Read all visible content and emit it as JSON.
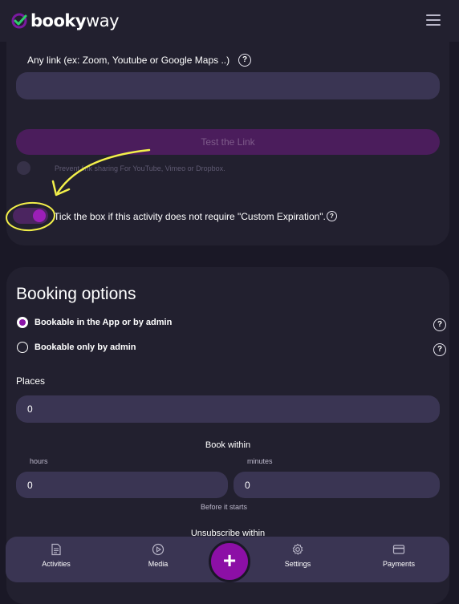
{
  "app": {
    "logo_bold": "booky",
    "logo_light": "way"
  },
  "link_section": {
    "label": "Any link (ex: Zoom, Youtube or Google Maps ..)",
    "value": "",
    "test_button": "Test the Link",
    "prevent_sharing_hint": "Prevent link sharing For YouTube, Vimeo or Dropbox.",
    "prevent_sharing_on": false,
    "custom_expiration_label": "Tick the box if this activity does not require \"Custom Expiration\".",
    "custom_expiration_on": true
  },
  "booking": {
    "title": "Booking options",
    "options": [
      {
        "label": "Bookable in the App or by admin",
        "selected": true
      },
      {
        "label": "Bookable only by admin",
        "selected": false
      }
    ],
    "places_label": "Places",
    "places_value": "0",
    "book_within_label": "Book within",
    "hours_label": "hours",
    "minutes_label": "minutes",
    "hours_value": "0",
    "minutes_value": "0",
    "before_label": "Before it starts",
    "unsubscribe_label": "Unsubscribe within"
  },
  "nav": {
    "items": [
      {
        "label": "Activities",
        "icon": "document-icon"
      },
      {
        "label": "Media",
        "icon": "play-icon"
      },
      {
        "label": "Settings",
        "icon": "gear-icon"
      },
      {
        "label": "Payments",
        "icon": "card-icon"
      }
    ],
    "fab": "+"
  },
  "colors": {
    "background": "#1a1826",
    "card": "#22202f",
    "input": "#3a3553",
    "accent": "#8c0fa6",
    "annotation": "#f3f04a"
  }
}
